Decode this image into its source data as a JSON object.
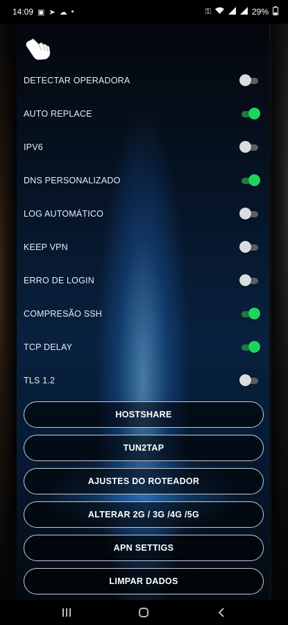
{
  "status": {
    "time": "14:09",
    "battery": "29%",
    "left_icons": [
      "image-icon",
      "telegram-icon",
      "cloud-icon",
      "dot-icon"
    ],
    "right_icons": [
      "key-icon",
      "wifi-icon",
      "signal-icon",
      "signal-icon",
      "battery-icon"
    ]
  },
  "toggles": [
    {
      "label": "DETECTAR OPERADORA",
      "on": false
    },
    {
      "label": "AUTO REPLACE",
      "on": true
    },
    {
      "label": "IPV6",
      "on": false
    },
    {
      "label": "DNS PERSONALIZADO",
      "on": true
    },
    {
      "label": "LOG AUTOMÁTICO",
      "on": false
    },
    {
      "label": "KEEP VPN",
      "on": false
    },
    {
      "label": "ERRO DE LOGIN",
      "on": false
    },
    {
      "label": "COMPRESÃO SSH",
      "on": true
    },
    {
      "label": "TCP DELAY",
      "on": true
    },
    {
      "label": "TLS 1.2",
      "on": false
    }
  ],
  "buttons": [
    {
      "label": "HOSTSHARE"
    },
    {
      "label": "TUN2TAP"
    },
    {
      "label": "AJUSTES DO ROTEADOR"
    },
    {
      "label": "ALTERAR 2G / 3G /4G /5G"
    },
    {
      "label": "APN SETTIGS"
    },
    {
      "label": "LIMPAR DADOS"
    }
  ],
  "colors": {
    "toggle_on": "#1ed45e",
    "toggle_off": "#d9dde0",
    "accent_glow": "#3a9cff"
  },
  "nav": [
    "recents-icon",
    "home-icon",
    "back-icon"
  ]
}
